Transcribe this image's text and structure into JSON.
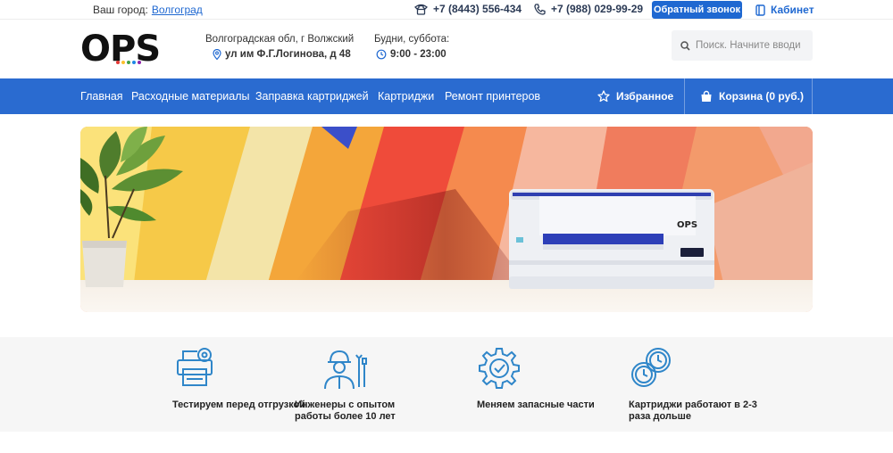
{
  "topbar": {
    "city_label": "Ваш город:",
    "city_value": "Волгоград",
    "phone1": "+7 (8443) 556-434",
    "phone2": "+7 (988) 029-99-29",
    "callback_label": "Обратный звонок",
    "cabinet_label": "Кабинет"
  },
  "header": {
    "logo_text": "OPS",
    "address_line1": "Волгоградская обл, г Волжский",
    "address_line2": "ул им Ф.Г.Логинова, д 48",
    "hours_line1": "Будни, суббота:",
    "hours_line2": "9:00 - 23:00",
    "search_placeholder": "Поиск. Начните вводи"
  },
  "nav": {
    "items": [
      {
        "label": "Главная"
      },
      {
        "label": "Расходные материалы"
      },
      {
        "label": "Заправка картриджей"
      },
      {
        "label": "Картриджи"
      },
      {
        "label": "Ремонт принтеров"
      }
    ],
    "favorites_label": "Избранное",
    "cart_label": "Корзина (0 руб.)"
  },
  "banner": {
    "printer_brand": "OPS"
  },
  "features": [
    {
      "text": "Тестируем перед отгрузкой",
      "icon": "printer-gear-icon"
    },
    {
      "text": "Инженеры с опытом работы более 10 лет",
      "icon": "engineer-tools-icon"
    },
    {
      "text": "Меняем запасные части",
      "icon": "gear-check-icon"
    },
    {
      "text": "Картриджи работают в 2-3 раза дольше",
      "icon": "clocks-icon"
    }
  ],
  "colors": {
    "accent": "#2a6bd0",
    "link": "#1f68d1",
    "icon": "#2f86c9"
  }
}
